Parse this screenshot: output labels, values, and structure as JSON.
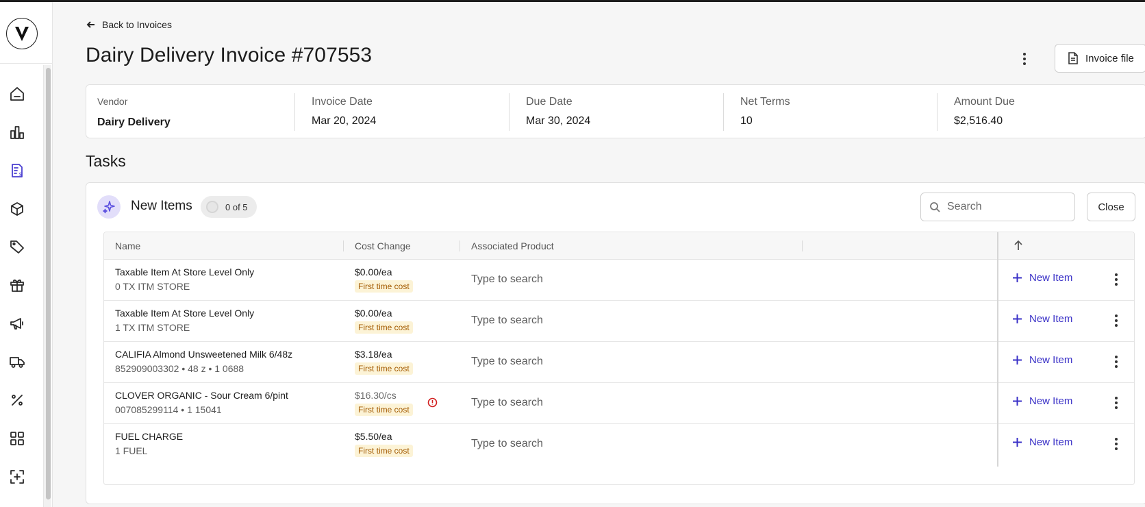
{
  "nav": {
    "back_label": "Back to Invoices",
    "items": [
      "home-icon",
      "chart-bar-icon",
      "invoice-icon",
      "box-icon",
      "tag-icon",
      "gift-icon",
      "megaphone-icon",
      "truck-icon",
      "percent-icon",
      "grid-icon",
      "scan-icon"
    ],
    "active": "invoice-icon"
  },
  "header": {
    "title": "Dairy Delivery Invoice #707553",
    "invoice_file_label": "Invoice file"
  },
  "summary": {
    "vendor_label": "Vendor",
    "vendor_value": "Dairy Delivery",
    "invoice_date_label": "Invoice Date",
    "invoice_date_value": "Mar 20, 2024",
    "due_date_label": "Due Date",
    "due_date_value": "Mar 30, 2024",
    "net_terms_label": "Net Terms",
    "net_terms_value": "10",
    "amount_due_label": "Amount Due",
    "amount_due_value": "$2,516.40"
  },
  "tasks": {
    "section_title": "Tasks",
    "heading": "New Items",
    "progress": "0 of 5",
    "search_placeholder": "Search",
    "close_label": "Close",
    "columns": {
      "name": "Name",
      "cost_change": "Cost Change",
      "associated_product": "Associated Product"
    },
    "rows": [
      {
        "name": "Taxable Item At Store Level Only",
        "sub": "0 TX ITM STORE",
        "cost": "$0.00/ea",
        "badge": "First time cost",
        "assoc_placeholder": "Type to search",
        "action": "New Item"
      },
      {
        "name": "Taxable Item At Store Level Only",
        "sub": "1 TX ITM STORE",
        "cost": "$0.00/ea",
        "badge": "First time cost",
        "assoc_placeholder": "Type to search",
        "action": "New Item"
      },
      {
        "name": "CALIFIA Almond Unsweetened Milk 6/48z",
        "sub": "852909003302 • 48 z • 1 0688",
        "cost": "$3.18/ea",
        "badge": "First time cost",
        "assoc_placeholder": "Type to search",
        "action": "New Item"
      },
      {
        "name": "CLOVER ORGANIC - Sour Cream 6/pint",
        "sub": "007085299114 • 1 15041",
        "cost": "$16.30/cs",
        "badge": "First time cost",
        "assoc_placeholder": "Type to search",
        "action": "New Item"
      },
      {
        "name": "FUEL CHARGE",
        "sub": "1 FUEL",
        "cost": "$5.50/ea",
        "badge": "First time cost",
        "assoc_placeholder": "Type to search",
        "action": "New Item"
      }
    ]
  },
  "colors": {
    "accent": "#3a31c7",
    "badge_bg": "#fcf3d6",
    "badge_text": "#a35a00",
    "warning": "#d11f1f"
  }
}
